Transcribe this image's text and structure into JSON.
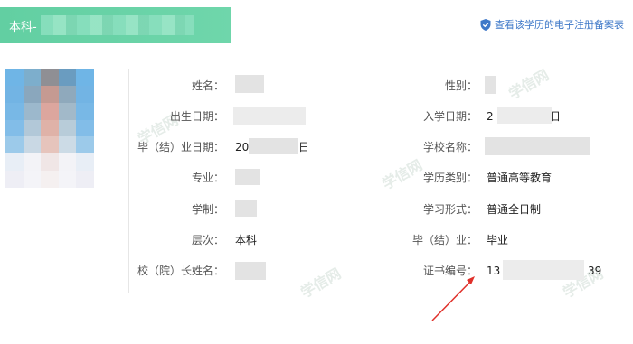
{
  "header": {
    "title": "本科-",
    "bg_color": "#62cfa2"
  },
  "verify_link": {
    "icon": "shield-icon",
    "label": "查看该学历的电子注册备案表",
    "color": "#3e78c8"
  },
  "photo": {
    "icon": "student-photo"
  },
  "left_fields": [
    {
      "label": "姓名：",
      "value": ""
    },
    {
      "label": "出生日期：",
      "value": ""
    },
    {
      "label": "毕（结）业日期：",
      "value": "20",
      "value_suffix": "日"
    },
    {
      "label": "专业：",
      "value": "",
      "value_suffix": ""
    },
    {
      "label": "学制：",
      "value": ""
    },
    {
      "label": "层次：",
      "value": "本科"
    },
    {
      "label": "校（院）长姓名：",
      "value": ""
    }
  ],
  "right_fields": [
    {
      "label": "性别：",
      "value": ""
    },
    {
      "label": "入学日期：",
      "value": "2",
      "value_suffix": "日"
    },
    {
      "label": "学校名称：",
      "value": ""
    },
    {
      "label": "学历类别：",
      "value": "普通高等教育"
    },
    {
      "label": "学习形式：",
      "value": "普通全日制"
    },
    {
      "label": "毕（结）业：",
      "value": "毕业"
    },
    {
      "label": "证书编号：",
      "value": "13",
      "value_suffix": "39"
    }
  ],
  "watermark": "学信网",
  "arrow_color": "#e0302a"
}
